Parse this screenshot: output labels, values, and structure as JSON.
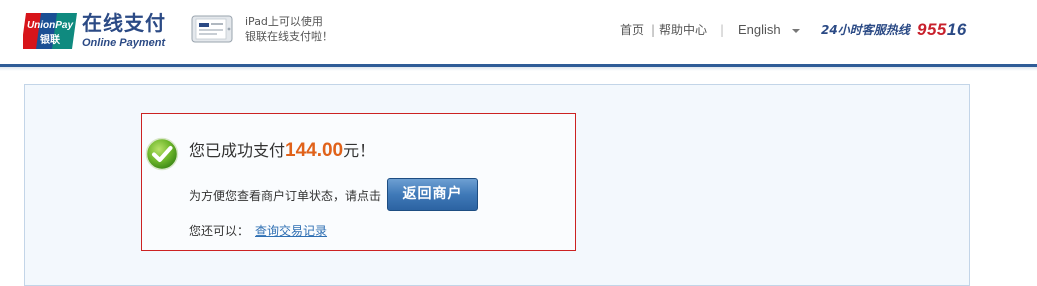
{
  "colors": {
    "brand_blue": "#2b4a85",
    "header_rule": "#2f5c97",
    "accent_red": "#c8202c",
    "amount_orange": "#e0621a",
    "panel_bg": "#f3f8fd",
    "result_border": "#cc2222",
    "button_blue": "#3f79b8",
    "link_blue": "#2f6fb3"
  },
  "header": {
    "logo": {
      "icon": "unionpay-logo",
      "text_top": "UnionPay",
      "text_bottom": "银联"
    },
    "brand_title": "在线支付",
    "brand_subtitle": "Online Payment",
    "promo": {
      "icon": "ipad-icon",
      "line1": "iPad上可以使用",
      "line2": "银联在线支付啦！"
    },
    "nav": {
      "home": "首页",
      "separator": "|",
      "help": "帮助中心",
      "lang_separator": "|",
      "language": "English"
    },
    "hotline": {
      "label": "24小时客服热线",
      "number_part1": "955",
      "number_part2": "16"
    }
  },
  "result": {
    "icon": "check-circle-icon",
    "success_prefix": "您已成功支付",
    "amount": "144.00",
    "success_suffix": "元！",
    "hint": "为方便您查看商户订单状态，请点击",
    "return_button": "返回商户",
    "also_label": "您还可以：",
    "query_link": "查询交易记录"
  }
}
